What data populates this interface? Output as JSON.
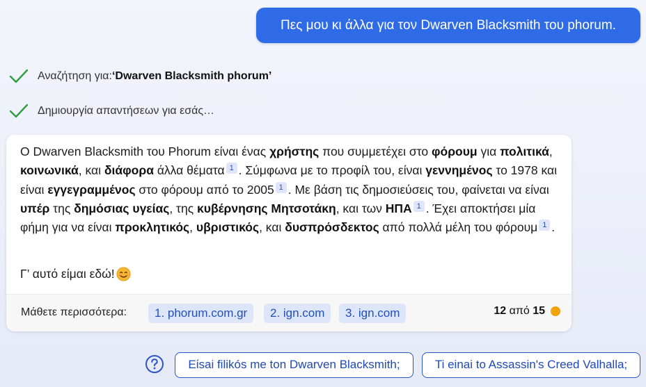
{
  "user_message": "Πες μου κι άλλα για τον Dwarven Blacksmith του phorum.",
  "status": {
    "search_prefix": "Αναζήτηση για: ",
    "search_query": "‘Dwarven Blacksmith phorum’",
    "generating": "Δημιουργία απαντήσεων για εσάς…"
  },
  "answer": {
    "cite_label": "1",
    "t1": "Ο Dwarven Blacksmith του Phorum είναι ένας ",
    "b1": "χρήστης",
    "t2": " που συμμετέχει στο ",
    "b2": "φόρουμ",
    "t3": " για ",
    "b3": "πολιτικά",
    "t4": ", ",
    "b4": "κοινωνικά",
    "t5": ", και ",
    "b5": "διάφορα",
    "t6": " άλλα θέματα",
    "t7": ". Σύμφωνα με το προφίλ του, είναι ",
    "b6": "γεννημένος",
    "t8": " το 1978 και είναι ",
    "b7": "εγγεγραμμένος",
    "t9": " στο φόρουμ από το 2005",
    "t10": ". Με βάση τις δημοσιεύσεις του, φαίνεται να είναι ",
    "b8": "υπέρ",
    "t11": " της ",
    "b9": "δημόσιας υγείας",
    "t12": ", της ",
    "b10": "κυβέρνησης Μητσοτάκη",
    "t13": ", και των ",
    "b11": "ΗΠΑ",
    "t14": ". Έχει αποκτήσει μία φήμη για να είναι ",
    "b12": "προκλητικός",
    "t15": ", ",
    "b13": "υβριστικός",
    "t16": ", και ",
    "b14": "δυσπρόσδεκτος",
    "t17": " από πολλά μέλη του φόρουμ",
    "t18": ".",
    "outro": "Γ’ αυτό είμαι εδώ!",
    "outro_icon": "smiling-face-icon"
  },
  "footer": {
    "learn_more": "Μάθετε περισσότερα:",
    "sources": [
      "1. phorum.com.gr",
      "2. ign.com",
      "3. ign.com"
    ],
    "counter_current": "12",
    "counter_sep": " από ",
    "counter_total": "15",
    "counter_dot_color": "#f0a30a"
  },
  "suggestions": [
    "Είsai filikós me ton Dwarven Blacksmith;",
    "Ti einai to Assassin's Creed Valhalla;"
  ],
  "colors": {
    "accent": "#2f6be6",
    "check": "#2e9e3e",
    "chip_bg": "#dde5f9"
  }
}
